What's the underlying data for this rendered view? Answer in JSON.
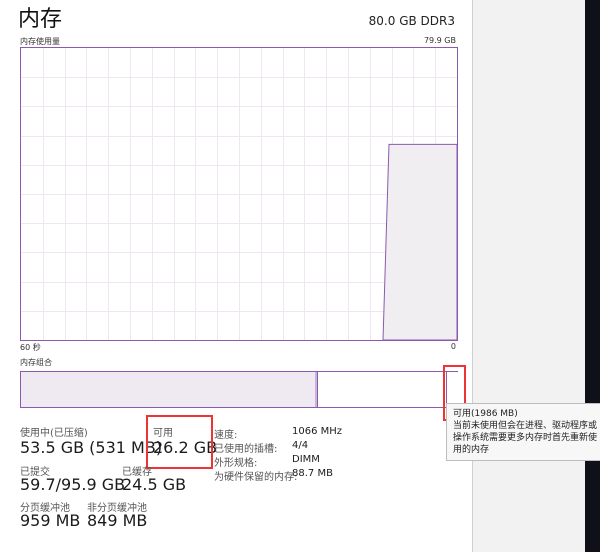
{
  "window": {
    "title": "内存",
    "total": "80.0 GB DDR3"
  },
  "graph": {
    "title": "内存使用量",
    "max_label": "79.9 GB",
    "left_time_label": "60 秒",
    "right_time_label": "0",
    "current_usage_fraction": 0.67
  },
  "composition": {
    "title": "内存组合"
  },
  "stats": {
    "in_use_label": "使用中(已压缩)",
    "in_use_value": "53.5 GB (531 MB)",
    "available_label": "可用",
    "available_value": "26.2 GB",
    "committed_label": "已提交",
    "committed_value": "59.7/95.9 GB",
    "cached_label": "已缓存",
    "cached_value": "24.5 GB",
    "paged_pool_label": "分页缓冲池",
    "paged_pool_value": "959 MB",
    "nonpaged_pool_label": "非分页缓冲池",
    "nonpaged_pool_value": "849 MB"
  },
  "details": {
    "speed_label": "速度:",
    "speed_value": "1066 MHz",
    "slots_label": "已使用的插槽:",
    "slots_value": "4/4",
    "form_label": "外形规格:",
    "form_value": "DIMM",
    "reserved_label": "为硬件保留的内存:",
    "reserved_value": "88.7 MB"
  },
  "tooltip": {
    "title": "可用(1986 MB)",
    "line1": "当前未使用但会在进程、驱动程序或",
    "line2": "操作系统需要更多内存时首先重新使",
    "line3": "用的内存"
  },
  "colors": {
    "accent": "#8c59b1",
    "highlight": "#e33333"
  }
}
